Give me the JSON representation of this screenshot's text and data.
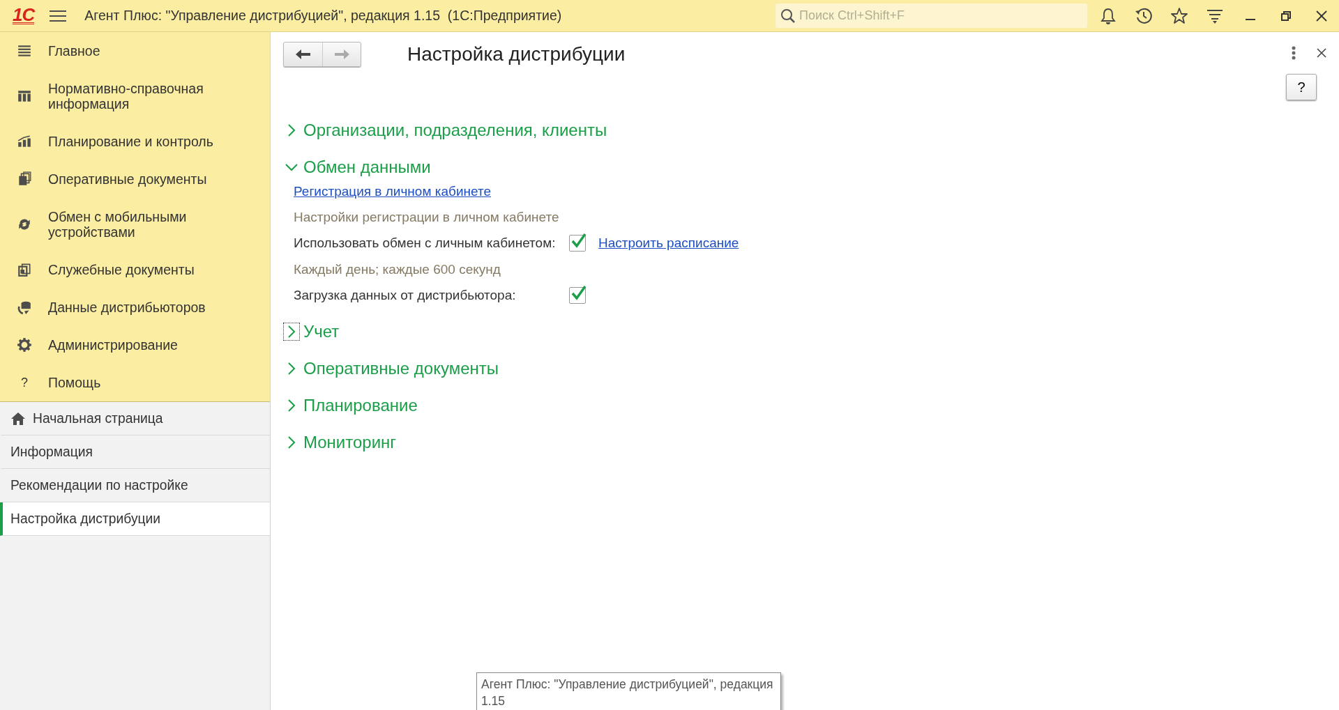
{
  "window": {
    "logo": "1С",
    "title": "Агент Плюс: \"Управление дистрибуцией\", редакция 1.15  (1С:Предприятие)",
    "search": {
      "placeholder": "Поиск Ctrl+Shift+F"
    }
  },
  "sections_panel": {
    "items": [
      {
        "label": "Главное"
      },
      {
        "label": "Нормативно-справочная информация"
      },
      {
        "label": "Планирование и контроль"
      },
      {
        "label": "Оперативные документы"
      },
      {
        "label": "Обмен с мобильными устройствами"
      },
      {
        "label": "Служебные документы"
      },
      {
        "label": "Данные дистрибьюторов"
      },
      {
        "label": "Администрирование"
      },
      {
        "label": "Помощь",
        "icon_text": "?"
      }
    ]
  },
  "nav_panel": {
    "items": [
      {
        "label": "Начальная страница",
        "kind": "home",
        "selected": false
      },
      {
        "label": "Информация",
        "kind": "plain",
        "selected": false
      },
      {
        "label": "Рекомендации по настройке",
        "kind": "plain",
        "selected": false
      },
      {
        "label": "Настройка дистрибуции",
        "kind": "plain",
        "selected": true
      }
    ]
  },
  "form": {
    "title": "Настройка дистрибуции",
    "help": "?",
    "sections": [
      {
        "title": "Организации, подразделения, клиенты",
        "expanded": false,
        "focused": false
      },
      {
        "title": "Обмен данными",
        "expanded": true,
        "focused": false,
        "fields": [
          {
            "kind": "link",
            "text": "Регистрация в личном кабинете"
          },
          {
            "kind": "note",
            "text": "Настройки регистрации в личном кабинете"
          },
          {
            "kind": "checkbox",
            "label": "Использовать обмен с личным кабинетом:",
            "checked": true,
            "link": "Настроить расписание"
          },
          {
            "kind": "note",
            "text": "Каждый день; каждые 600 секунд"
          },
          {
            "kind": "checkbox",
            "label": "Загрузка данных от дистрибьютора:",
            "checked": true
          }
        ]
      },
      {
        "title": "Учет",
        "expanded": false,
        "focused": true
      },
      {
        "title": "Оперативные документы",
        "expanded": false,
        "focused": false
      },
      {
        "title": "Планирование",
        "expanded": false,
        "focused": false
      },
      {
        "title": "Мониторинг",
        "expanded": false,
        "focused": false
      }
    ]
  },
  "tooltip": {
    "text": "Агент Плюс: \"Управление дистрибуцией\", редакция 1.15"
  }
}
